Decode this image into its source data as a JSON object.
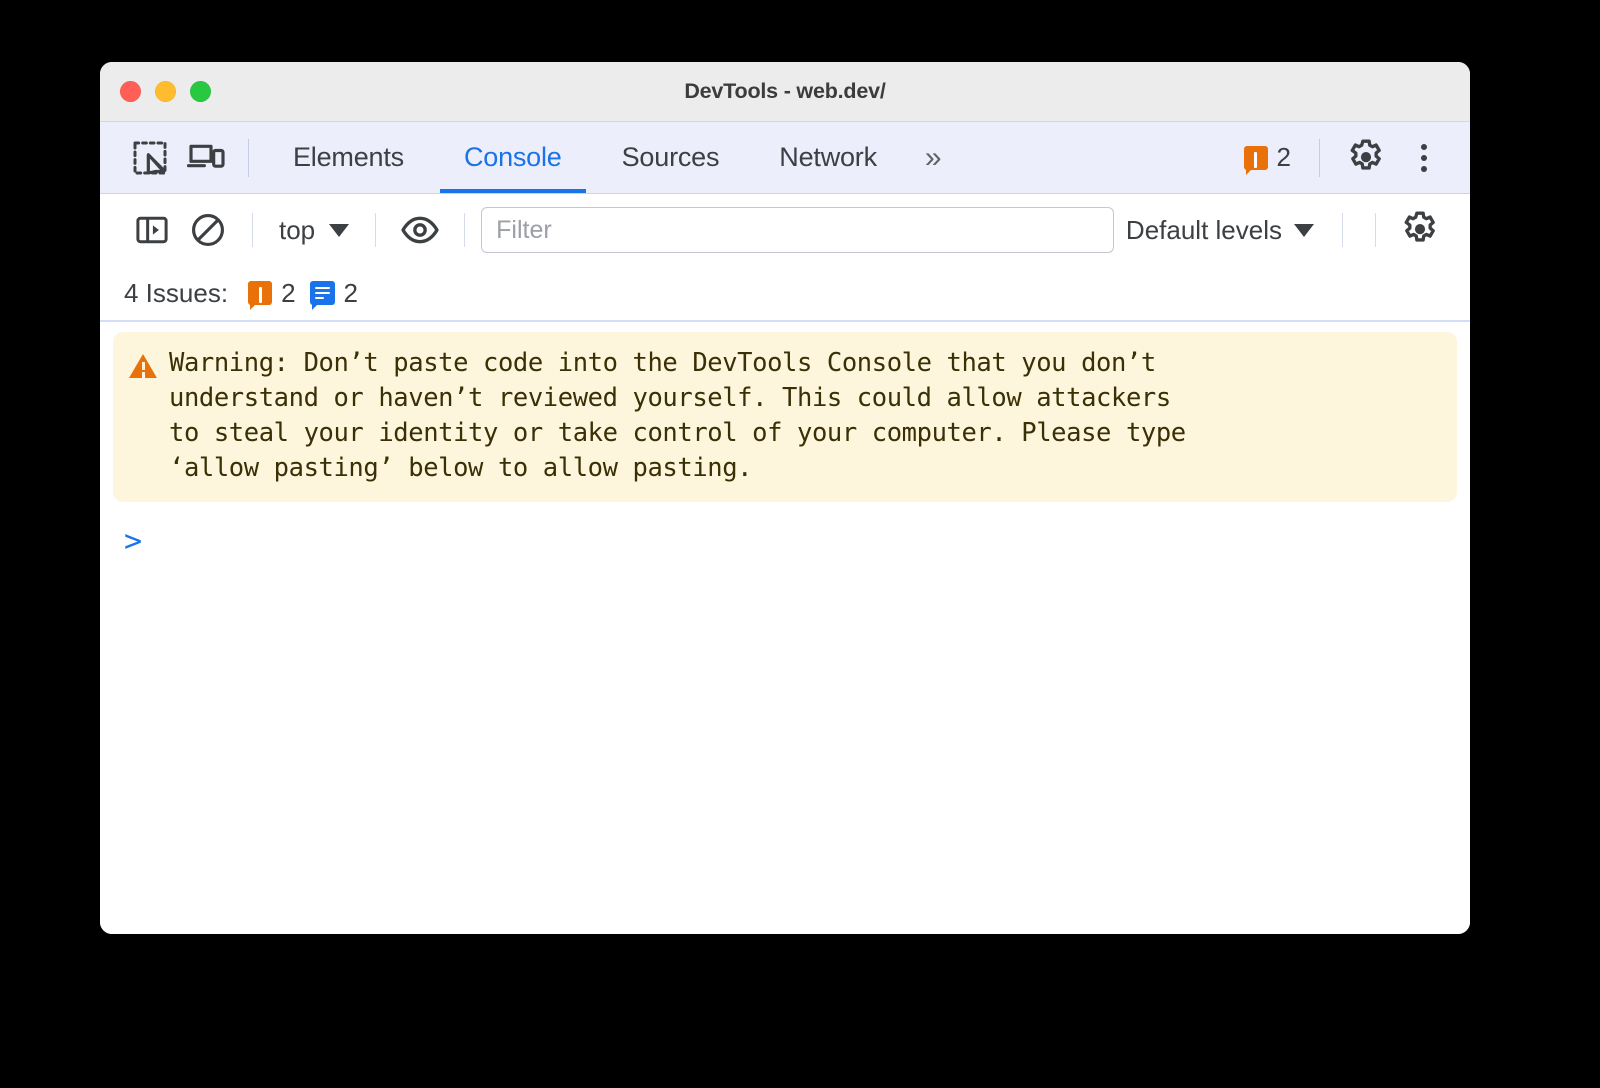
{
  "window": {
    "title": "DevTools - web.dev/",
    "traffic_lights": [
      "close",
      "minimize",
      "maximize"
    ]
  },
  "tabstrip": {
    "inspect_icon": "inspect-element-icon",
    "device_icon": "device-toolbar-icon",
    "tabs": [
      {
        "label": "Elements",
        "active": false
      },
      {
        "label": "Console",
        "active": true
      },
      {
        "label": "Sources",
        "active": false
      },
      {
        "label": "Network",
        "active": false
      }
    ],
    "more_tabs": "»",
    "issue_count": "2",
    "settings_icon": "gear-icon",
    "more_options_icon": "kebab-menu-icon"
  },
  "console_toolbar": {
    "sidebar_icon": "console-sidebar-icon",
    "clear_icon": "clear-console-icon",
    "context": "top",
    "eye_icon": "live-expression-eye-icon",
    "filter_placeholder": "Filter",
    "filter_value": "",
    "levels": "Default levels",
    "settings_icon": "console-settings-gear-icon"
  },
  "issues_bar": {
    "label": "4 Issues:",
    "warning_count": "2",
    "info_count": "2"
  },
  "console_body": {
    "warning_message": "Warning: Don’t paste code into the DevTools Console that you don’t\nunderstand or haven’t reviewed yourself. This could allow attackers\nto steal your identity or take control of your computer. Please type\n‘allow pasting’ below to allow pasting.",
    "prompt_symbol": ">",
    "prompt_value": ""
  },
  "colors": {
    "accent_blue": "#1a73e8",
    "warning_orange": "#e8710a",
    "warning_bg": "#fdf6dd",
    "tabstrip_bg": "#eceefb",
    "titlebar_bg": "#ececec"
  }
}
